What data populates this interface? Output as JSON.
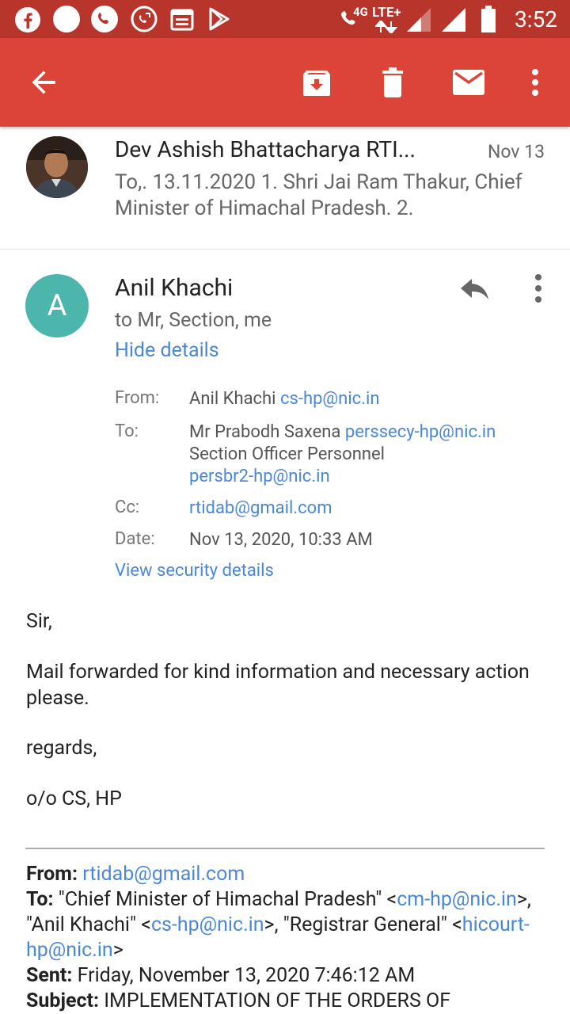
{
  "status_bar": {
    "time": "3:52",
    "network_4g": "4G",
    "network_lte": "LTE+"
  },
  "app_bar": {
    "icons": [
      "back-arrow-icon",
      "archive-icon",
      "delete-icon",
      "mark-unread-icon",
      "more-vert-icon"
    ]
  },
  "collapsed_message": {
    "sender": "Dev Ashish Bhattacharya RTI...",
    "date": "Nov 13",
    "snippet": "To,. 13.11.2020 1. Shri Jai Ram Thakur, Chief Minister of Himachal Pradesh. 2."
  },
  "message": {
    "avatar_letter": "A",
    "avatar_color": "#4db6ac",
    "sender": "Anil Khachi",
    "recipients_summary": "to Mr, Section, me",
    "hide_details": "Hide details",
    "details": {
      "from_label": "From:",
      "from_name": "Anil Khachi",
      "from_email": "cs-hp@nic.in",
      "to_label": "To:",
      "to_name1": "Mr Prabodh Saxena",
      "to_email1": "perssecy-hp@nic.in",
      "to_name2": "Section Officer Personnel",
      "to_email2": "persbr2-hp@nic.in",
      "cc_label": "Cc:",
      "cc_email": "rtidab@gmail.com",
      "date_label": "Date:",
      "date_value": "Nov 13, 2020, 10:33 AM"
    },
    "security_link": "View security details",
    "body": {
      "greeting": "Sir,",
      "line1": "Mail forwarded for kind information and necessary action please.",
      "regards": "regards,",
      "signature": "o/o CS, HP"
    },
    "quoted": {
      "from_label": "From:",
      "from_email": "rtidab@gmail.com",
      "to_label": "To:",
      "to_part1": "\"Chief Minister of Himachal Pradesh\" <",
      "to_email1": "cm-hp@nic.in",
      "to_part2": ">, \"Anil Khachi\" <",
      "to_email2": "cs-hp@nic.in",
      "to_part3": ">, \"Registrar General\" <",
      "to_email3": "hicourt-hp@nic.in",
      "to_part4": ">",
      "sent_label": "Sent:",
      "sent_value": "Friday, November 13, 2020 7:46:12 AM",
      "subject_label": "Subject:",
      "subject_value": "IMPLEMENTATION OF THE ORDERS OF"
    }
  },
  "colors": {
    "status_bar": "#b8352b",
    "app_bar": "#db4437",
    "link": "#4a88d6"
  }
}
